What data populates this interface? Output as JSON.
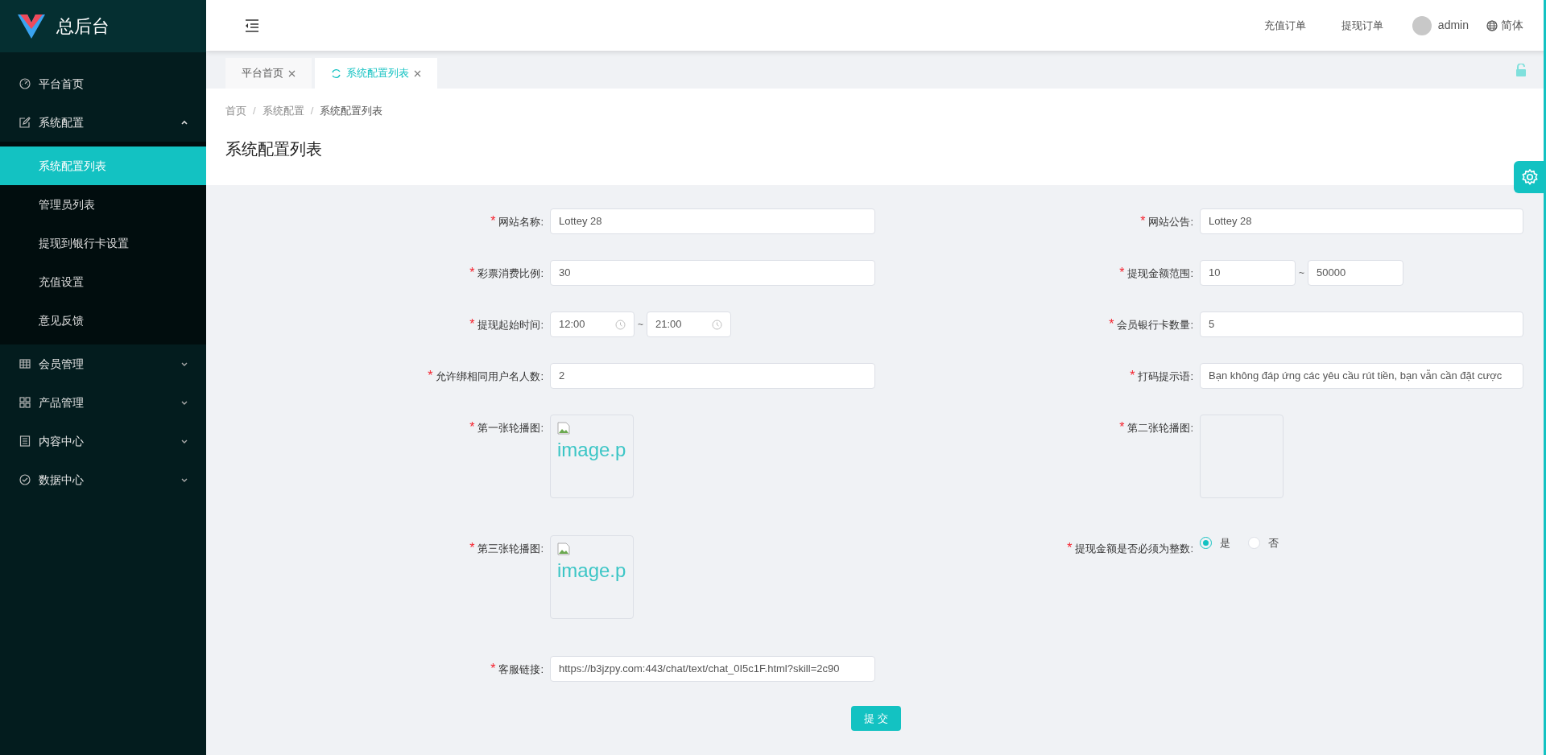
{
  "brand": {
    "title": "总后台"
  },
  "menu": [
    {
      "kind": "link",
      "label": "平台首页",
      "selected": false
    },
    {
      "kind": "group",
      "label": "系统配置",
      "expanded": true,
      "children": [
        {
          "label": "系统配置列表",
          "selected": true
        },
        {
          "label": "管理员列表",
          "selected": false
        },
        {
          "label": "提现到银行卡设置",
          "selected": false
        },
        {
          "label": "充值设置",
          "selected": false
        },
        {
          "label": "意见反馈",
          "selected": false
        }
      ]
    },
    {
      "kind": "group",
      "label": "会员管理",
      "expanded": false
    },
    {
      "kind": "group",
      "label": "产品管理",
      "expanded": false
    },
    {
      "kind": "group",
      "label": "内容中心",
      "expanded": false
    },
    {
      "kind": "group",
      "label": "数据中心",
      "expanded": false
    }
  ],
  "header": {
    "links": [
      "充值订单",
      "提现订单"
    ],
    "user": "admin",
    "language": "简体"
  },
  "tabs": [
    {
      "label": "平台首页",
      "selected": false
    },
    {
      "label": "系统配置列表",
      "selected": true
    }
  ],
  "breadcrumb": {
    "separator": "/",
    "items": [
      "首页",
      "系统配置",
      "系统配置列表"
    ]
  },
  "page_title": "系统配置列表",
  "form": {
    "rows": [
      {
        "left": {
          "kind": "text",
          "required": "*",
          "label": "网站名称:",
          "value": "Lottey 28"
        },
        "right": {
          "kind": "text",
          "required": "*",
          "label": "网站公告:",
          "value": "Lottey 28"
        }
      },
      {
        "left": {
          "kind": "text",
          "required": "*",
          "label": "彩票消费比例:",
          "value": "30"
        },
        "right": {
          "kind": "range",
          "required": "*",
          "label": "提现金额范围:",
          "from": "10",
          "separator": "~",
          "to": "50000"
        }
      },
      {
        "left": {
          "kind": "time_range",
          "required": "*",
          "label": "提现起始时间:",
          "from": "12:00",
          "separator": "~",
          "to": "21:00"
        },
        "right": {
          "kind": "text",
          "required": "*",
          "label": "会员银行卡数量:",
          "value": "5"
        }
      },
      {
        "left": {
          "kind": "text",
          "required": "*",
          "label": "允许绑相同用户名人数:",
          "value": "2"
        },
        "right": {
          "kind": "text",
          "required": "*",
          "label": "打码提示语:",
          "value": "Bạn không đáp ứng các yêu cầu rút tiền, bạn vẫn cần đặt cược"
        }
      },
      {
        "left": {
          "kind": "image",
          "required": "*",
          "label": "第一张轮播图:",
          "alt": "image.p"
        },
        "right": {
          "kind": "image",
          "required": "*",
          "label": "第二张轮播图:"
        }
      },
      {
        "left": {
          "kind": "image",
          "required": "*",
          "label": "第三张轮播图:",
          "alt": "image.p"
        },
        "right": {
          "kind": "radio",
          "required": "*",
          "label": "提现金额是否必须为整数:",
          "options": [
            {
              "label": "是",
              "selected": true
            },
            {
              "label": "否",
              "selected": false
            }
          ]
        }
      },
      {
        "left": {
          "kind": "text",
          "required": "*",
          "label": "客服链接:",
          "value": "https://b3jzpy.com:443/chat/text/chat_0I5c1F.html?skill=2c90"
        }
      }
    ],
    "submit": "提 交"
  }
}
